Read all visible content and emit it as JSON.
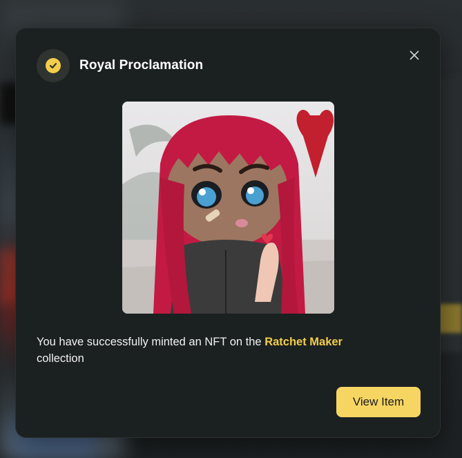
{
  "modal": {
    "title": "Royal Proclamation",
    "message_prefix": "You have successfully minted an NFT on the ",
    "collection_name": "Ratchet Maker",
    "message_suffix": "collection",
    "view_button_label": "View Item",
    "close_icon": "close-icon",
    "status_icon": "check-circle-icon",
    "image_alt": "NFT artwork"
  },
  "colors": {
    "accent": "#f2ce4a",
    "button_bg": "#f7d563",
    "modal_bg": "#1b2021"
  }
}
